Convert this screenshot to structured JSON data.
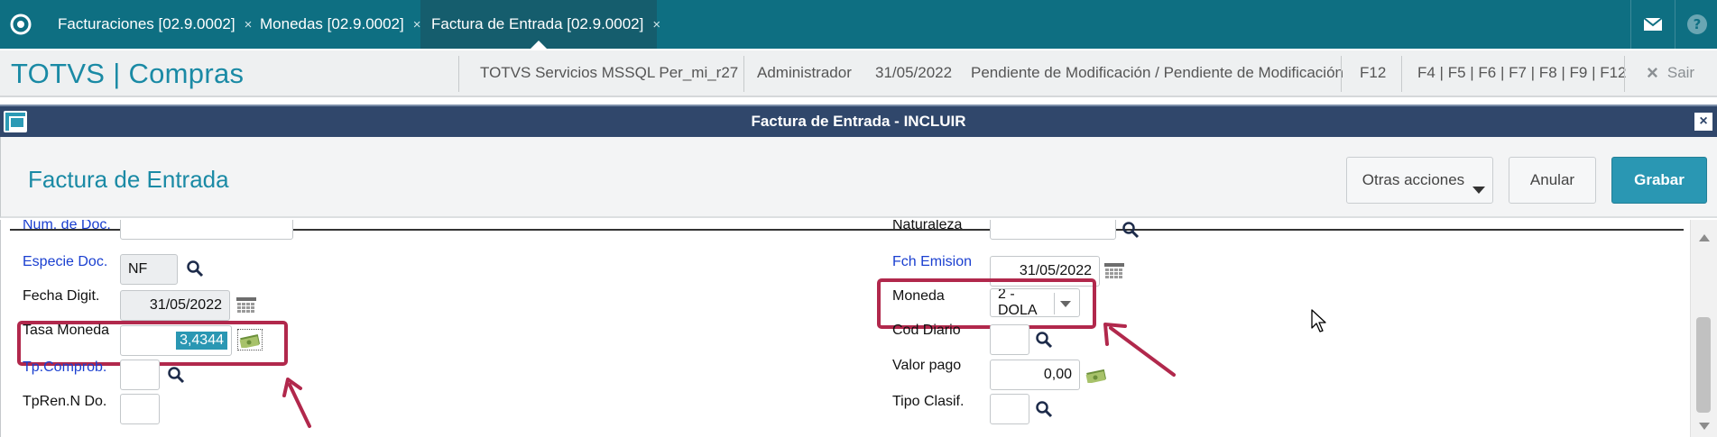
{
  "topbar": {
    "tabs": [
      {
        "label": "Facturaciones [02.9.0002]",
        "close": "×"
      },
      {
        "label": "Monedas [02.9.0002]",
        "close": "×"
      },
      {
        "label": "Factura de Entrada [02.9.0002]",
        "close": "×"
      }
    ],
    "icons": [
      "logo-icon",
      "mail-icon",
      "help-icon"
    ]
  },
  "appbar": {
    "title": "TOTVS | Compras",
    "environment": "TOTVS Servicios MSSQL Per_mi_r27",
    "user": "Administrador",
    "date": "31/05/2022",
    "status": "Pendiente de Modificación / Pendiente de Modificación",
    "f12": "F12",
    "shortcuts": "F4 | F5 | F6 | F7 | F8 | F9 | F12",
    "exit_label": "Sair",
    "exit_icon": "×"
  },
  "dialog": {
    "title": "Factura de Entrada - INCLUIR",
    "close": "×"
  },
  "form": {
    "title": "Factura de Entrada",
    "buttons": {
      "other_actions": "Otras acciones",
      "cancel": "Anular",
      "save": "Grabar"
    },
    "left": {
      "num_doc_label": "Num. de Doc.",
      "especie_label": "Especie Doc.",
      "especie_value": "NF",
      "fecha_digit_label": "Fecha Digit.",
      "fecha_digit_value": "31/05/2022",
      "tasa_label": "Tasa Moneda",
      "tasa_value": "3,4344",
      "tp_comprob_label": "Tp.Comprob.",
      "tpren_label": "TpRen.N Do."
    },
    "right": {
      "naturaleza_label": "Naturaleza",
      "fch_emision_label": "Fch Emision",
      "fch_emision_value": "31/05/2022",
      "moneda_label": "Moneda",
      "moneda_value": "2 - DOLA",
      "cod_diario_label": "Cod Diario",
      "valor_pago_label": "Valor pago",
      "valor_pago_value": "0,00",
      "tipo_clasif_label": "Tipo Clasif."
    }
  },
  "colors": {
    "topbar": "#0e6f82",
    "accent": "#2a97b3",
    "dialog_header": "#30476b",
    "annotation": "#b1284c",
    "link_label": "#1a3fd0"
  }
}
